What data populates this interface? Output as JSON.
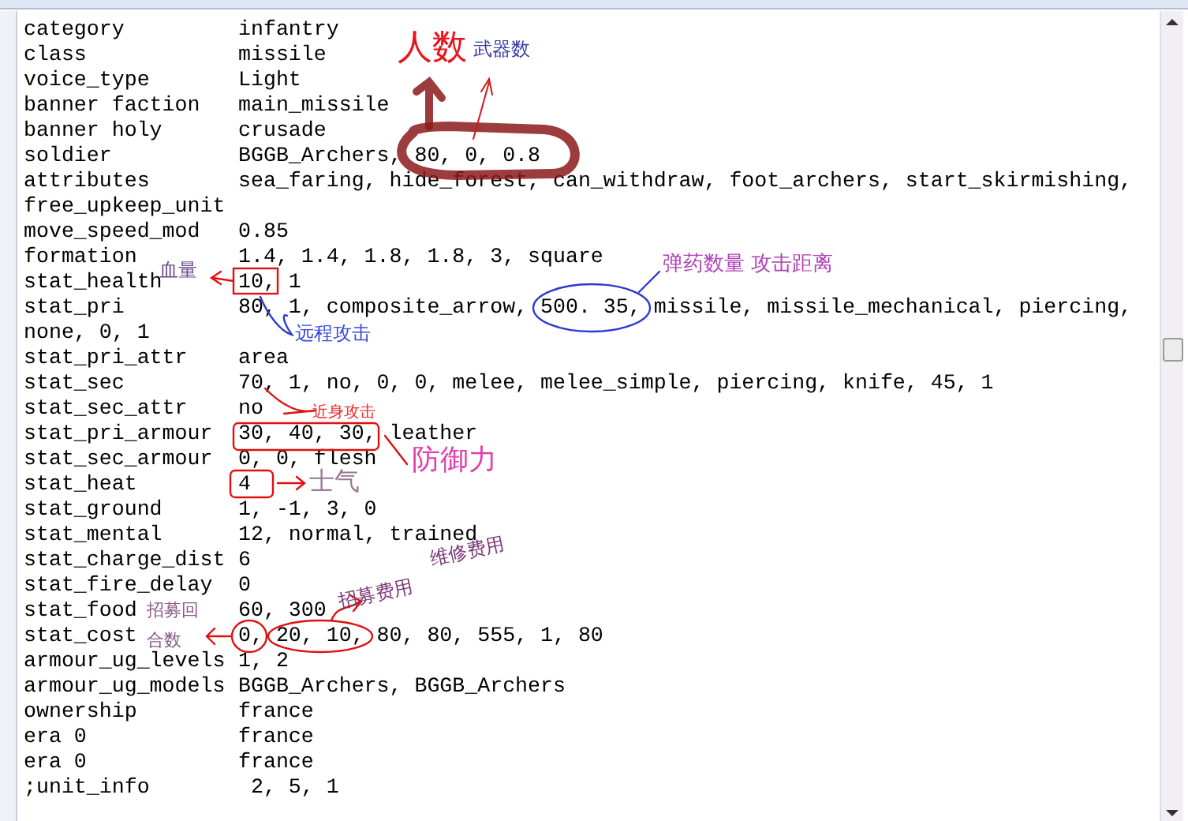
{
  "editor": {
    "lines": [
      {
        "key": "category",
        "value": "infantry"
      },
      {
        "key": "class",
        "value": "missile"
      },
      {
        "key": "voice_type",
        "value": "Light"
      },
      {
        "key": "banner faction",
        "value": "main_missile"
      },
      {
        "key": "banner holy",
        "value": "crusade"
      },
      {
        "key": "soldier",
        "value": "BGGB_Archers, 80, 0, 0.8"
      },
      {
        "key": "attributes",
        "value": "sea_faring, hide_forest, can_withdraw, foot_archers, start_skirmishing,"
      },
      {
        "key": "free_upkeep_unit"
      },
      {
        "key": "move_speed_mod",
        "value": "0.85"
      },
      {
        "key": "formation",
        "value": "1.4, 1.4, 1.8, 1.8, 3, square"
      },
      {
        "key": "stat_health",
        "value": "10, 1"
      },
      {
        "key": "stat_pri",
        "value": "80, 1, composite_arrow, 500. 35, missile, missile_mechanical, piercing,"
      },
      {
        "key": "none, 0, 1"
      },
      {
        "key": "stat_pri_attr",
        "value": "area"
      },
      {
        "key": "stat_sec",
        "value": "70, 1, no, 0, 0, melee, melee_simple, piercing, knife, 45, 1"
      },
      {
        "key": "stat_sec_attr",
        "value": "no"
      },
      {
        "key": "stat_pri_armour",
        "value": "30, 40, 30, leather"
      },
      {
        "key": "stat_sec_armour",
        "value": "0, 0, flesh"
      },
      {
        "key": "stat_heat",
        "value": "4"
      },
      {
        "key": "stat_ground",
        "value": "1, -1, 3, 0"
      },
      {
        "key": "stat_mental",
        "value": "12, normal, trained"
      },
      {
        "key": "stat_charge_dist",
        "value": "6"
      },
      {
        "key": "stat_fire_delay",
        "value": "0"
      },
      {
        "key": "stat_food",
        "value": "60, 300"
      },
      {
        "key": "stat_cost",
        "value": "0, 20, 10, 80, 80, 555, 1, 80"
      },
      {
        "key": "armour_ug_levels",
        "value": "1, 2"
      },
      {
        "key": "armour_ug_models",
        "value": "BGGB_Archers, BGGB_Archers"
      },
      {
        "key": "ownership",
        "value": "france"
      },
      {
        "key": "era 0",
        "value": "france"
      },
      {
        "key": "era 0",
        "value": "france"
      },
      {
        "key": ";unit_info",
        "value": " 2, 5, 1"
      }
    ]
  },
  "annotations": [
    {
      "text": "人数",
      "color": "#e8141c"
    },
    {
      "text": "武器数",
      "color": "#3a3aa8"
    },
    {
      "text": "血量",
      "color": "#6a4a8a"
    },
    {
      "text": "远程攻击",
      "color": "#3a4ad8"
    },
    {
      "text": "弹药数量 攻击距离",
      "color": "#b040b8"
    },
    {
      "text": "近身攻击",
      "color": "#f02828"
    },
    {
      "text": "防御力",
      "color": "#e040a8"
    },
    {
      "text": "士气",
      "color": "#9a7898"
    },
    {
      "text": "招募费用",
      "color": "#7a3a78"
    },
    {
      "text": "维修费用",
      "color": "#7a3a78"
    },
    {
      "text": "招募回",
      "color": "#8a5a8a"
    },
    {
      "text": "合数",
      "color": "#8a5a8a"
    }
  ]
}
